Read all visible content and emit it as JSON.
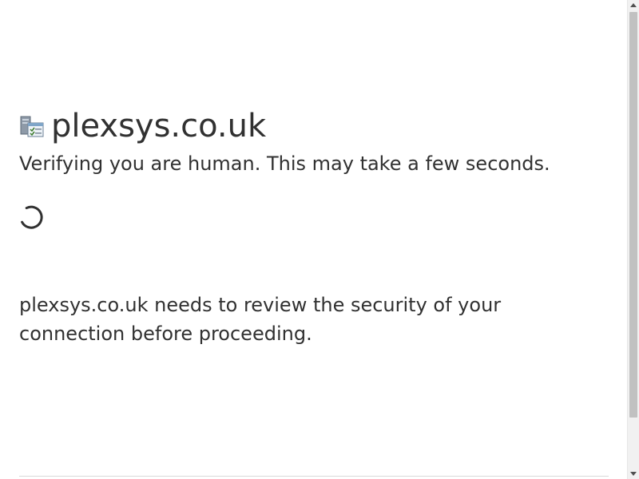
{
  "site": {
    "name": "plexsys.co.uk",
    "icon": "site-favicon-icon"
  },
  "status": {
    "subtitle": "Verifying you are human. This may take a few seconds.",
    "spinner": "loading-spinner-icon"
  },
  "notice": {
    "text": "plexsys.co.uk needs to review the security of your connection before proceeding."
  },
  "colors": {
    "text": "#313131",
    "divider": "#d9d9d9",
    "scrollbar_thumb": "#c1c1c1"
  }
}
